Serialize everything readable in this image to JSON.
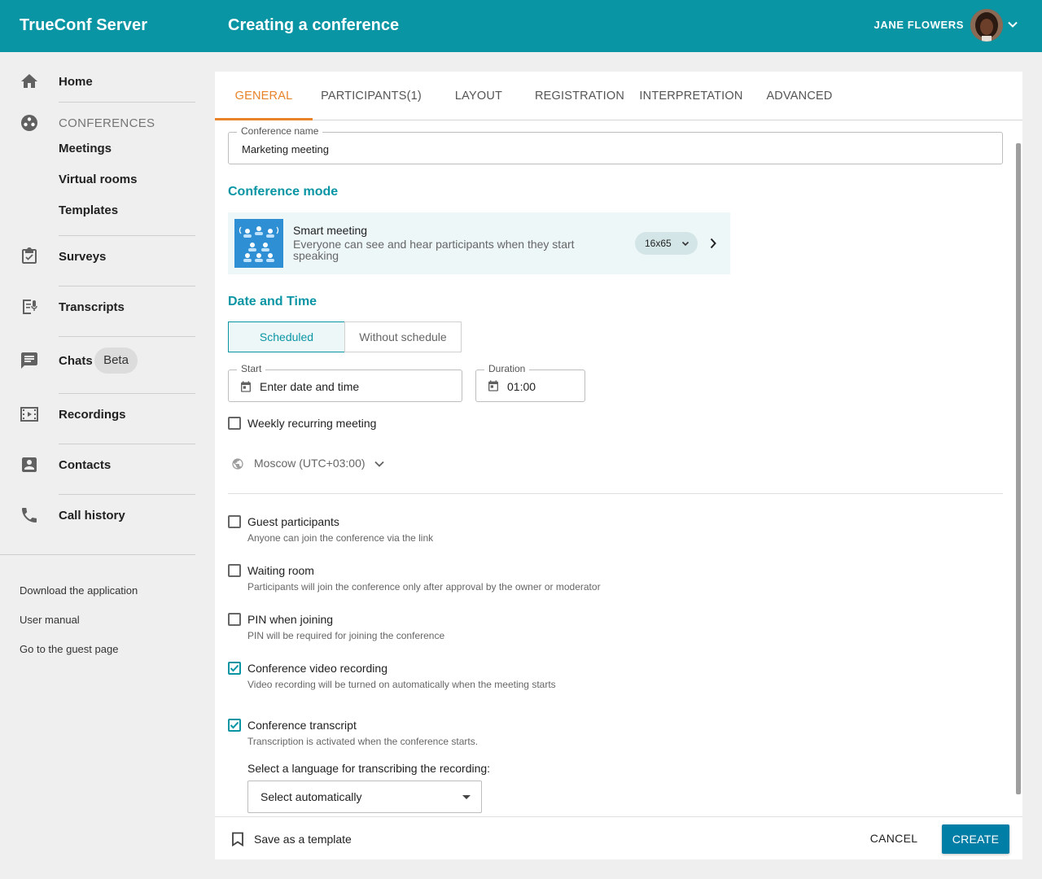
{
  "header": {
    "brand": "TrueConf Server",
    "title": "Creating a conference",
    "user_name": "JANE FLOWERS"
  },
  "sidebar": {
    "home": "Home",
    "conferences_section": "CONFERENCES",
    "meetings": "Meetings",
    "virtual_rooms": "Virtual rooms",
    "templates": "Templates",
    "surveys": "Surveys",
    "transcripts": "Transcripts",
    "chats": "Chats",
    "chats_badge": "Beta",
    "recordings": "Recordings",
    "contacts": "Contacts",
    "call_history": "Call history",
    "footer": {
      "download": "Download the application",
      "manual": "User manual",
      "guest_page": "Go to the guest page"
    }
  },
  "tabs": [
    "GENERAL",
    "PARTICIPANTS(1)",
    "LAYOUT",
    "REGISTRATION",
    "INTERPRETATION",
    "ADVANCED"
  ],
  "form": {
    "conference_name_label": "Conference name",
    "conference_name_value": "Marketing meeting",
    "conference_mode_title": "Conference mode",
    "mode": {
      "title": "Smart meeting",
      "description": "Everyone can see and hear participants when they start speaking",
      "layout_chip": "16x65"
    },
    "date_time_title": "Date and Time",
    "schedule_options": {
      "scheduled": "Scheduled",
      "without": "Without schedule"
    },
    "start_label": "Start",
    "start_placeholder": "Enter date and time",
    "duration_label": "Duration",
    "duration_value": "01:00",
    "weekly_recurring": "Weekly recurring meeting",
    "timezone": "Moscow (UTC+03:00)",
    "options": [
      {
        "label": "Guest participants",
        "desc": "Anyone can join the conference via the link",
        "checked": false
      },
      {
        "label": "Waiting room",
        "desc": "Participants will join the conference only after approval by the owner or moderator",
        "checked": false
      },
      {
        "label": "PIN when joining",
        "desc": "PIN will be required for joining the conference",
        "checked": false
      },
      {
        "label": "Conference video recording",
        "desc": "Video recording will be turned on automatically when the meeting starts",
        "checked": true
      },
      {
        "label": "Conference transcript",
        "desc": "Transcription is activated when the conference starts.",
        "checked": true
      }
    ],
    "language_label": "Select a language for transcribing the recording:",
    "language_value": "Select automatically"
  },
  "footer": {
    "save_template": "Save as a template",
    "cancel": "CANCEL",
    "create": "CREATE"
  },
  "colors": {
    "header": "#0a95a5",
    "active_tab": "#e8832a",
    "create_button": "#007ea6"
  }
}
